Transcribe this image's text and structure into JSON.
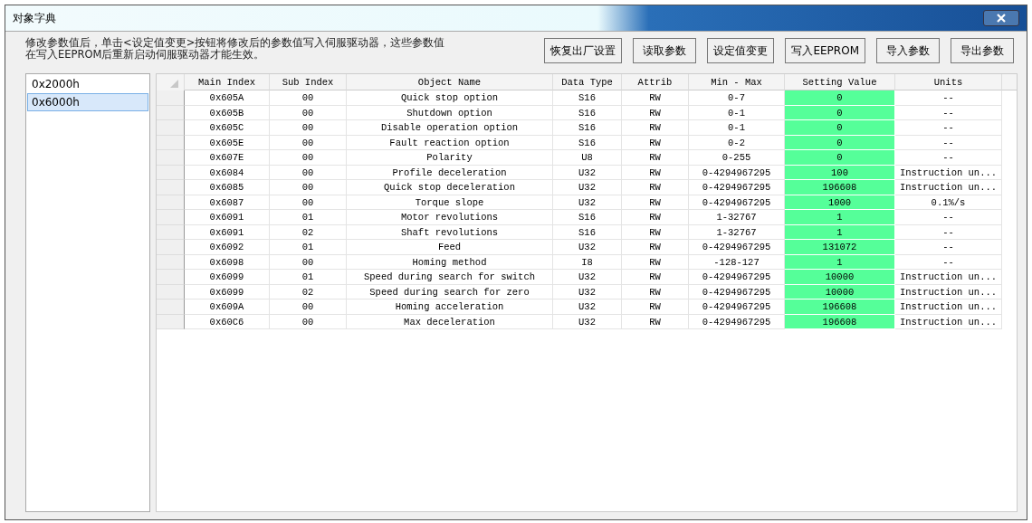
{
  "window": {
    "title": "对象字典"
  },
  "notice": "修改参数值后，单击<设定值变更>按钮将修改后的参数值写入伺服驱动器，这些参数值在写入EEPROM后重新启动伺服驱动器才能生效。",
  "buttons": [
    "恢复出厂设置",
    "读取参数",
    "设定值变更",
    "写入EEPROM",
    "导入参数",
    "导出参数"
  ],
  "sidebar": {
    "items": [
      {
        "label": "0x2000h",
        "selected": false
      },
      {
        "label": "0x6000h",
        "selected": true
      }
    ]
  },
  "table": {
    "columns": [
      "Main Index",
      "Sub Index",
      "Object Name",
      "Data Type",
      "Attrib",
      "Min - Max",
      "Setting Value",
      "Units"
    ],
    "rows": [
      [
        "0x605A",
        "00",
        "Quick stop option",
        "S16",
        "RW",
        "0-7",
        "0",
        "--"
      ],
      [
        "0x605B",
        "00",
        "Shutdown option",
        "S16",
        "RW",
        "0-1",
        "0",
        "--"
      ],
      [
        "0x605C",
        "00",
        "Disable operation option",
        "S16",
        "RW",
        "0-1",
        "0",
        "--"
      ],
      [
        "0x605E",
        "00",
        "Fault reaction option",
        "S16",
        "RW",
        "0-2",
        "0",
        "--"
      ],
      [
        "0x607E",
        "00",
        "Polarity",
        "U8",
        "RW",
        "0-255",
        "0",
        "--"
      ],
      [
        "0x6084",
        "00",
        "Profile deceleration",
        "U32",
        "RW",
        "0-4294967295",
        "100",
        "Instruction un..."
      ],
      [
        "0x6085",
        "00",
        "Quick stop deceleration",
        "U32",
        "RW",
        "0-4294967295",
        "196608",
        "Instruction un..."
      ],
      [
        "0x6087",
        "00",
        "Torque slope",
        "U32",
        "RW",
        "0-4294967295",
        "1000",
        "0.1%/s"
      ],
      [
        "0x6091",
        "01",
        "Motor revolutions",
        "S16",
        "RW",
        "1-32767",
        "1",
        "--"
      ],
      [
        "0x6091",
        "02",
        "Shaft revolutions",
        "S16",
        "RW",
        "1-32767",
        "1",
        "--"
      ],
      [
        "0x6092",
        "01",
        "Feed",
        "U32",
        "RW",
        "0-4294967295",
        "131072",
        "--"
      ],
      [
        "0x6098",
        "00",
        "Homing method",
        "I8",
        "RW",
        "-128-127",
        "1",
        "--"
      ],
      [
        "0x6099",
        "01",
        "Speed during search for switch",
        "U32",
        "RW",
        "0-4294967295",
        "10000",
        "Instruction un..."
      ],
      [
        "0x6099",
        "02",
        "Speed during search for zero",
        "U32",
        "RW",
        "0-4294967295",
        "10000",
        "Instruction un..."
      ],
      [
        "0x609A",
        "00",
        "Homing acceleration",
        "U32",
        "RW",
        "0-4294967295",
        "196608",
        "Instruction un..."
      ],
      [
        "0x60C6",
        "00",
        "Max deceleration",
        "U32",
        "RW",
        "0-4294967295",
        "196608",
        "Instruction un..."
      ]
    ]
  }
}
